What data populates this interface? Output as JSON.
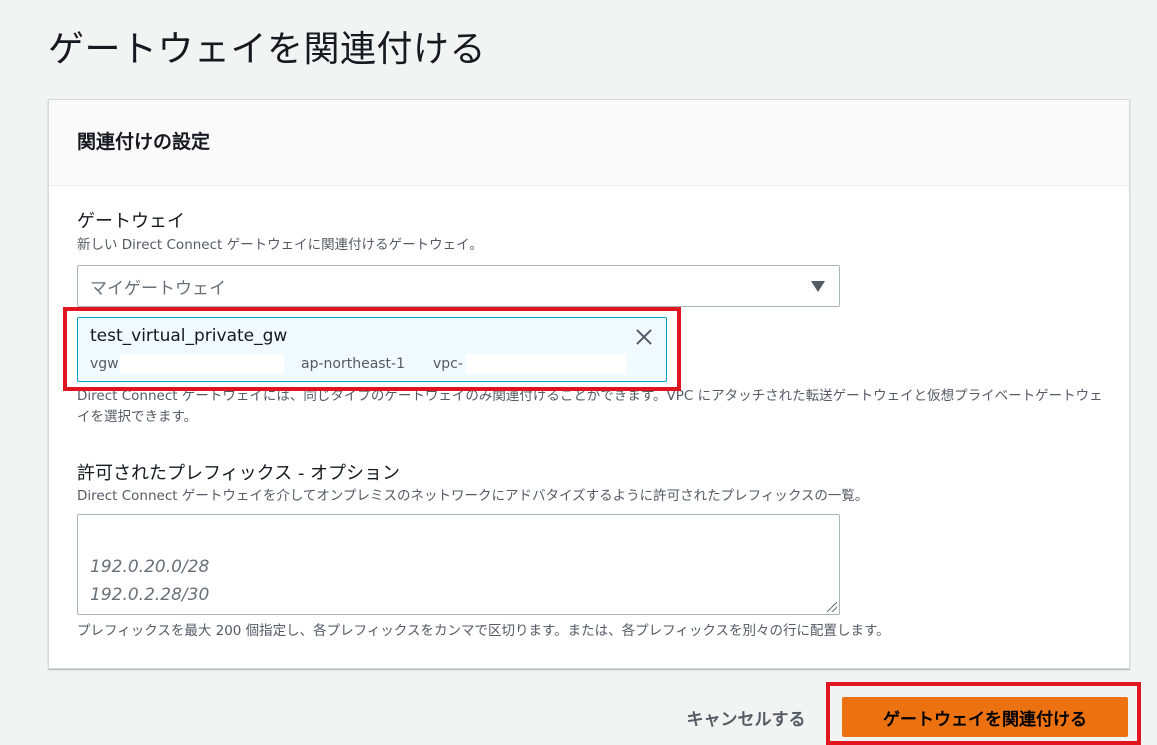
{
  "page": {
    "title": "ゲートウェイを関連付ける"
  },
  "settings": {
    "header": "関連付けの設定",
    "gateway": {
      "label": "ゲートウェイ",
      "description": "新しい Direct Connect ゲートウェイに関連付けるゲートウェイ。",
      "placeholder": "マイゲートウェイ",
      "selected": {
        "name": "test_virtual_private_gw",
        "id_prefix": "vgw",
        "region": "ap-northeast-1",
        "vpc_prefix": "vpc-"
      },
      "hint": "Direct Connect ゲートウェイには、同じタイプのゲートウェイのみ関連付けることができます。VPC にアタッチされた転送ゲートウェイと仮想プライベートゲートウェイを選択できます。"
    },
    "prefixes": {
      "label": "許可されたプレフィックス - オプション",
      "description": "Direct Connect ゲートウェイを介してオンプレミスのネットワークにアドバタイズするように許可されたプレフィックスの一覧。",
      "placeholder": "192.0.20.0/28\n192.0.2.28/30",
      "hint": "プレフィックスを最大 200 個指定し、各プレフィックスをカンマで区切ります。または、各プレフィックスを別々の行に配置します。"
    }
  },
  "actions": {
    "cancel_label": "キャンセルする",
    "submit_label": "ゲートウェイを関連付ける"
  },
  "colors": {
    "primary": "#ec7211",
    "highlight": "#e0151f",
    "token_bg": "#f1faff",
    "token_border": "#00a1c9"
  }
}
